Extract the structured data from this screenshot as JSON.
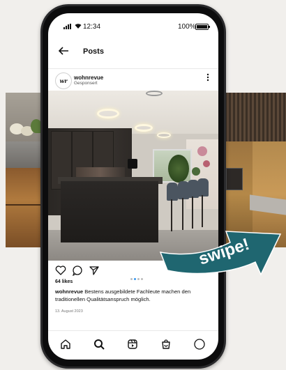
{
  "status_bar": {
    "time": "12:34",
    "battery_percent": "100%"
  },
  "nav": {
    "title": "Posts"
  },
  "post": {
    "account_name": "wohnrevue",
    "account_subtitle": "Gesponsert",
    "avatar_logo_text": "wr",
    "likes": "64 likes",
    "caption_author": "wohnrevue",
    "caption_text": " Bestens ausgebildete Fachleute machen den traditionellen Qualitätsanspruch möglich.",
    "date": "13. August 2023",
    "carousel": {
      "pages": 4,
      "active_index": 1
    }
  },
  "overlay": {
    "swipe_text": "swipe!"
  },
  "icons": {
    "back": "arrow-left-icon",
    "more": "more-vertical-icon",
    "like": "heart-icon",
    "comment": "comment-icon",
    "share": "send-icon",
    "home": "home-icon",
    "search": "search-icon",
    "reels": "reels-icon",
    "shop": "shop-icon",
    "profile": "profile-icon"
  },
  "colors": {
    "swipe_banner": "#1f6670",
    "carousel_active": "#3897f0",
    "phone_frame": "#2a2a2c",
    "page_background": "#f1efec"
  }
}
